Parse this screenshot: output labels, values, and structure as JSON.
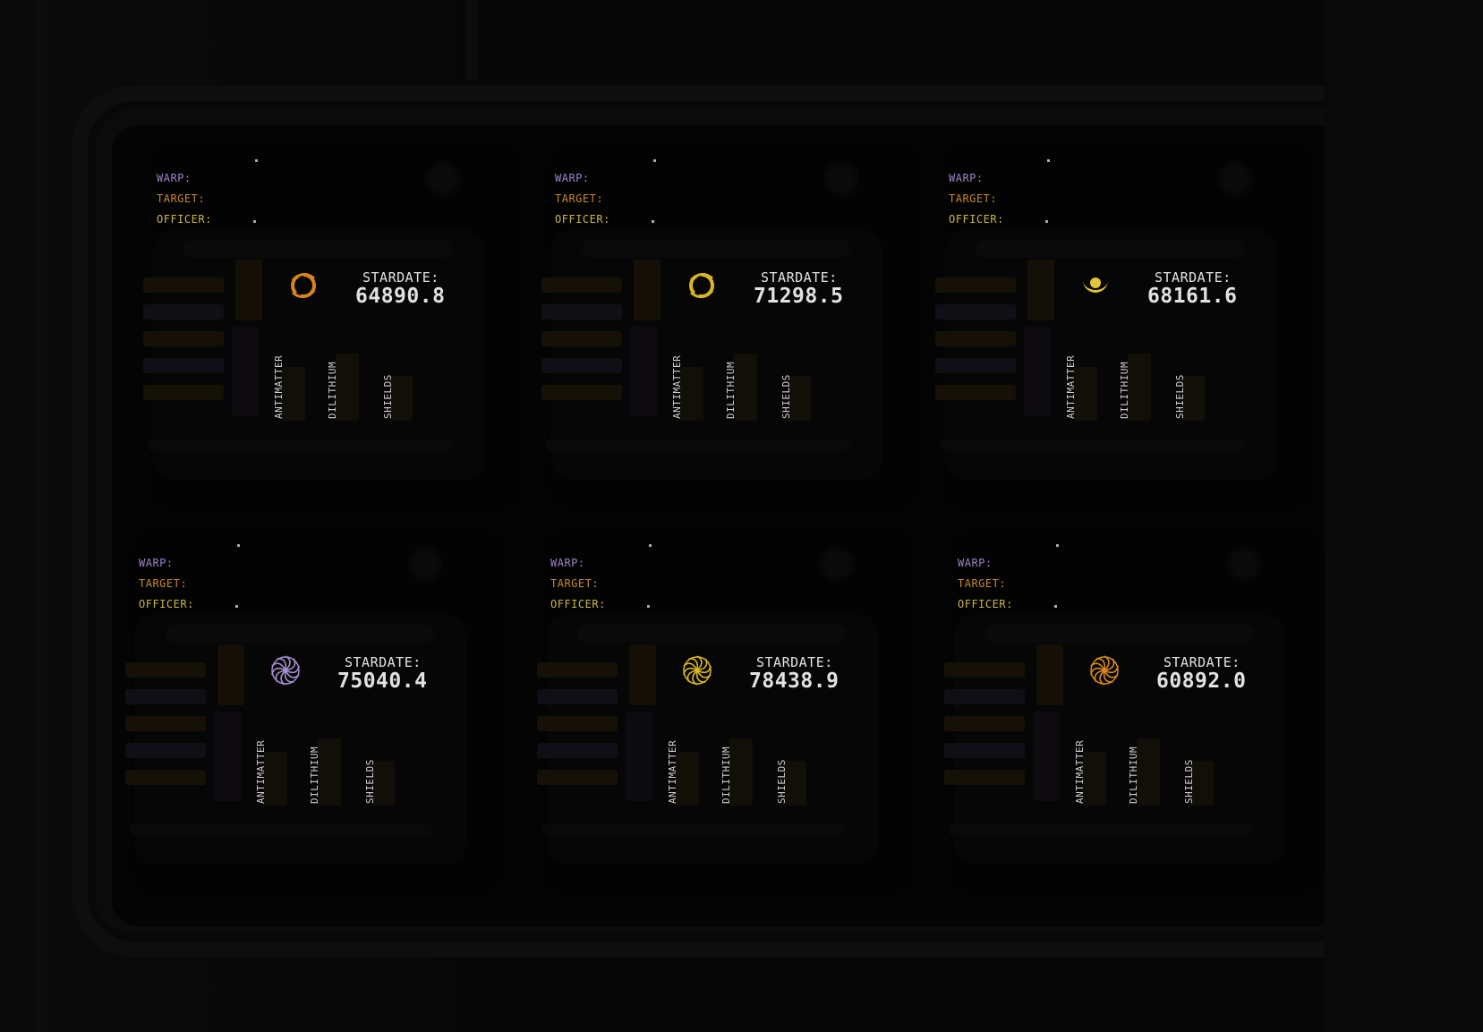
{
  "labels": {
    "warp": "WARP:",
    "target": "TARGET:",
    "officer": "OFFICER:",
    "stardate": "STARDATE:",
    "antimatter": "ANTIMATTER",
    "dilithium": "DILITHIUM",
    "shields": "SHIELDS"
  },
  "panels": [
    {
      "warp_label": "WARP:",
      "target_label": "TARGET:",
      "officer_label": "OFFICER:",
      "stardate_label": "STARDATE:",
      "stardate": "64890.8",
      "emblem": "swirl-ring-icon",
      "emblem_color": "#d7841e",
      "antimatter_label": "ANTIMATTER",
      "dilithium_label": "DILITHIUM",
      "shields_label": "SHIELDS"
    },
    {
      "warp_label": "WARP:",
      "target_label": "TARGET:",
      "officer_label": "OFFICER:",
      "stardate_label": "STARDATE:",
      "stardate": "71298.5",
      "emblem": "swirl-ring-icon",
      "emblem_color": "#d8b62a",
      "antimatter_label": "ANTIMATTER",
      "dilithium_label": "DILITHIUM",
      "shields_label": "SHIELDS"
    },
    {
      "warp_label": "WARP:",
      "target_label": "TARGET:",
      "officer_label": "OFFICER:",
      "stardate_label": "STARDATE:",
      "stardate": "68161.6",
      "emblem": "crescent-eye-icon",
      "emblem_color": "#e2c43a",
      "antimatter_label": "ANTIMATTER",
      "dilithium_label": "DILITHIUM",
      "shields_label": "SHIELDS"
    },
    {
      "warp_label": "WARP:",
      "target_label": "TARGET:",
      "officer_label": "OFFICER:",
      "stardate_label": "STARDATE:",
      "stardate": "75040.4",
      "emblem": "spiral-orb-icon",
      "emblem_color": "#a58fd0",
      "antimatter_label": "ANTIMATTER",
      "dilithium_label": "DILITHIUM",
      "shields_label": "SHIELDS"
    },
    {
      "warp_label": "WARP:",
      "target_label": "TARGET:",
      "officer_label": "OFFICER:",
      "stardate_label": "STARDATE:",
      "stardate": "78438.9",
      "emblem": "spiral-orb-icon",
      "emblem_color": "#d9b928",
      "antimatter_label": "ANTIMATTER",
      "dilithium_label": "DILITHIUM",
      "shields_label": "SHIELDS"
    },
    {
      "warp_label": "WARP:",
      "target_label": "TARGET:",
      "officer_label": "OFFICER:",
      "stardate_label": "STARDATE:",
      "stardate": "60892.0",
      "emblem": "spiral-orb-icon",
      "emblem_color": "#d88a22",
      "antimatter_label": "ANTIMATTER",
      "dilithium_label": "DILITHIUM",
      "shields_label": "SHIELDS"
    }
  ],
  "colors": {
    "warp": "#9c83c4",
    "target": "#c58828",
    "officer": "#c9b44a",
    "text": "#e2e2e2"
  }
}
